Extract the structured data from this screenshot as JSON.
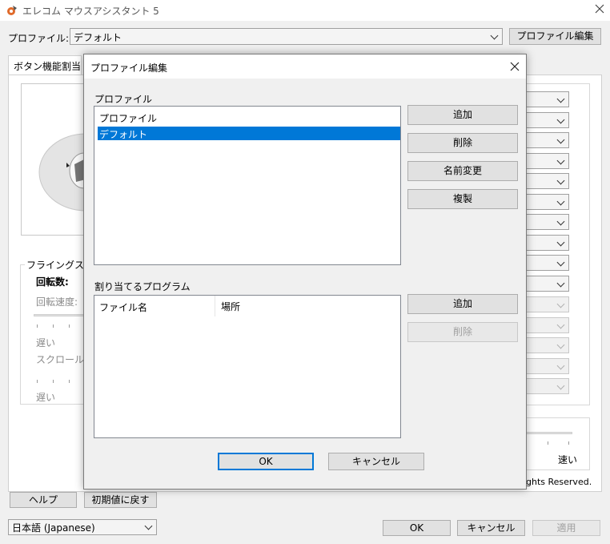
{
  "app": {
    "title": "エレコム マウスアシスタント 5"
  },
  "main": {
    "profile_label": "プロファイル:",
    "profile_value": "デフォルト",
    "profile_edit_button": "プロファイル編集",
    "tab_button_assign": "ボタン機能割当",
    "flying_scroll_label": "フライングスクロ",
    "rotation_label": "回転数:",
    "rotation_speed_label": "回転速度:",
    "slow_label_1": "遅い",
    "scroll_speed_label": "スクロール速",
    "slow_label_2": "遅い",
    "fast_label": "速い",
    "copyright_fragment": "ghts Reserved.",
    "help_button": "ヘルプ",
    "reset_button": "初期値に戻す",
    "language_value": "日本語 (Japanese)",
    "ok_button": "OK",
    "cancel_button": "キャンセル",
    "apply_button": "適用"
  },
  "dialog": {
    "title": "プロファイル編集",
    "profile_group_label": "プロファイル",
    "profile_list": [
      "プロファイル",
      "デフォルト"
    ],
    "selected_index": 1,
    "add_button": "追加",
    "delete_button": "削除",
    "rename_button": "名前変更",
    "duplicate_button": "複製",
    "program_group_label": "割り当てるプログラム",
    "columns": [
      "ファイル名",
      "場所"
    ],
    "program_add_button": "追加",
    "program_delete_button": "削除",
    "ok_button": "OK",
    "cancel_button": "キャンセル"
  },
  "colors": {
    "accent": "#0078d7",
    "selection": "#0078d7",
    "background": "#f0f0f0"
  }
}
